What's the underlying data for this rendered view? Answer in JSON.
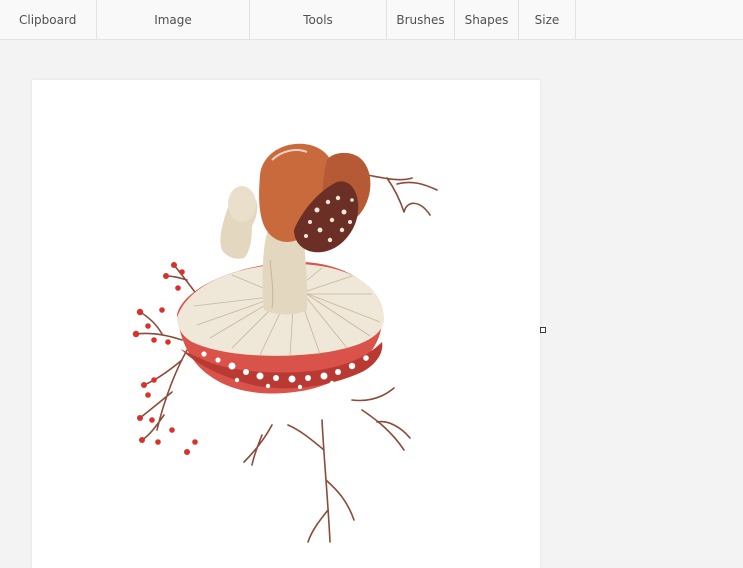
{
  "ribbon": {
    "clipboard": "Clipboard",
    "image": "Image",
    "tools": "Tools",
    "brushes": "Brushes",
    "shapes": "Shapes",
    "size": "Size"
  },
  "colors": {
    "ribbon_bg": "#f9f9f9",
    "workspace_bg": "#f3f3f3",
    "canvas_bg": "#ffffff",
    "red_cap": "#d9534a",
    "brown_cap": "#c96a3c",
    "gill": "#efe7d8",
    "stem": "#e3d7bf",
    "berry": "#d7322b",
    "twig": "#8a4b3a"
  },
  "icons": {
    "canvas_picture": "mushroom-illustration",
    "handle": "resize-handle"
  }
}
